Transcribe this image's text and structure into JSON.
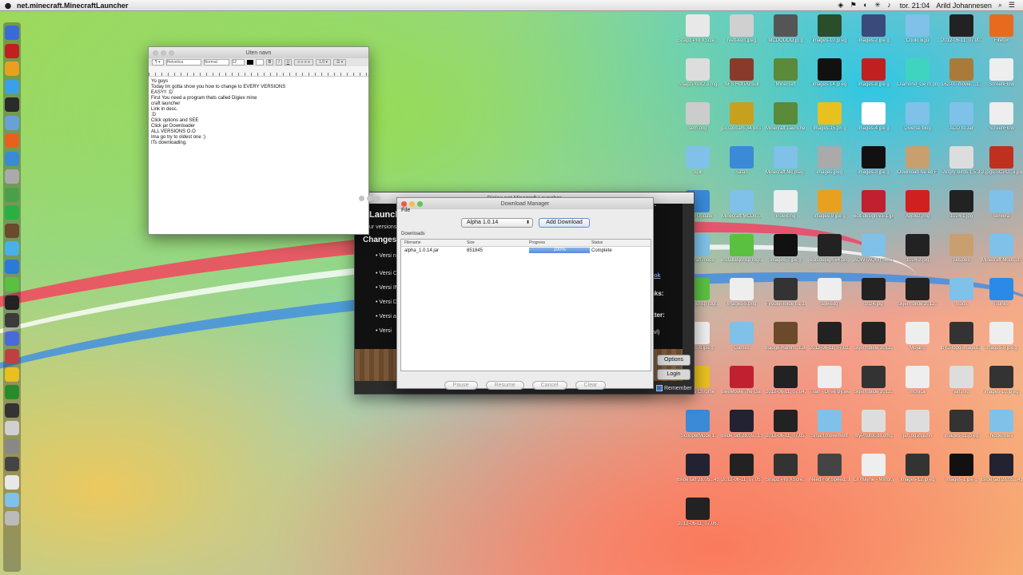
{
  "menubar": {
    "app_name": "net.minecraft.MinecraftLauncher",
    "clock": "tor. 21:04",
    "user": "Arild Johannesen"
  },
  "textedit": {
    "title": "Uten navn",
    "font": "Helvetica",
    "style": "Normal",
    "size": "12",
    "lines": [
      "Yo guys",
      "Today Im gotta show you how to change to EVERY VERSIONS",
      "EASY!! :D",
      "First You need a program thats called Digiex mine",
      "craft launcher",
      "Link in desc.",
      ":D",
      "Click options and SEE",
      "Click jar Downloader",
      "ALL VERSIONS O.O",
      "Ima go try to oldest one :)",
      "ITs downloading."
    ]
  },
  "launcher": {
    "title": "Digiex.net Minecraft Launcher",
    "launcher_label": "Launcher",
    "version_fragment": "ur versions",
    "changes_heading": "Changes",
    "bullets": [
      "Versi now l",
      "Versi Cons unus",
      "Versi IMPO Pleas",
      "Versi Delet",
      "Versi abilit if you",
      "Versi"
    ],
    "right_fragments": [
      "s:",
      "nks:",
      "itter:",
      "evl)",
      "ook"
    ],
    "options_label": "Options",
    "login_label": "Login",
    "remember_label": "Remember"
  },
  "download_manager": {
    "title": "Download Manager",
    "menu_file": "File",
    "selected_version": "Alpha 1.0.14",
    "add_download": "Add Download",
    "section": "Downloads",
    "columns": [
      "Filename",
      "Size",
      "Progress",
      "Status"
    ],
    "rows": [
      {
        "filename": "alpha_1.0.14.jar",
        "size": "851845",
        "progress": "100%",
        "status": "Complete",
        "progress_fraction": 1.0
      }
    ],
    "buttons": [
      "Pause",
      "Resume",
      "Cancel",
      "Clear"
    ]
  },
  "desktop_icons": [
    {
      "label": "Snapz Pro XScre...1.jpeg",
      "color": "#e8e8e8"
    },
    {
      "label": "Nett-kerr.jpeg",
      "color": "#d0d0d0"
    },
    {
      "label": "MCDODOO.jp g",
      "color": "#555"
    },
    {
      "label": "images-10.jp eg",
      "color": "#2a4d2a"
    },
    {
      "label": "images-2.jpe g",
      "color": "#3a4a7a"
    },
    {
      "label": "Coolo Iiigo",
      "color": "#7fc1e8"
    },
    {
      "label": "2012-06-11, 07.00.07.jpeg",
      "color": "#222"
    },
    {
      "label": "Firefox",
      "color": "#e86a1e"
    },
    {
      "label": "SnapzProX2.e mg",
      "color": "#ddd"
    },
    {
      "label": "NFS Hot Pursuit",
      "color": "#8a3a2a"
    },
    {
      "label": "Minecraft",
      "color": "#5a8a3a"
    },
    {
      "label": "images-14.jp eg",
      "color": "#111"
    },
    {
      "label": "images-8.jpe g",
      "color": "#c02020"
    },
    {
      "label": "Diamond_Ge m.png",
      "color": "#3fd4c0"
    },
    {
      "label": "162-00-movie....1.jpg",
      "color": "#aa7a3a"
    },
    {
      "label": "ScreenFlow",
      "color": "#eee"
    },
    {
      "label": "sem.png",
      "color": "#ccc"
    },
    {
      "label": "picspocam-34 8837...1.jpg",
      "color": "#c8a020"
    },
    {
      "label": "Minecraft Launcher",
      "color": "#5a8a3a"
    },
    {
      "label": "images-15.pn g",
      "color": "#e8c020"
    },
    {
      "label": "images-4.jpe g",
      "color": "#fff"
    },
    {
      "label": "Diverse blog",
      "color": "#7fc1e8"
    },
    {
      "label": "ADD to Jar",
      "color": "#7fc1e8"
    },
    {
      "label": "ScreenFlow",
      "color": "#eee"
    },
    {
      "label": "Spill",
      "color": "#7fc1e8"
    },
    {
      "label": "Safari",
      "color": "#3a8ad8"
    },
    {
      "label": "Minecraft Mc play...mele",
      "color": "#7fc1e8"
    },
    {
      "label": "images.jpeg",
      "color": "#aaa"
    },
    {
      "label": "images-3.jpe g",
      "color": "#111"
    },
    {
      "label": "Download Ne ed Fo....Zaexe",
      "color": "#c8a070"
    },
    {
      "label": "Angry Birds 1.5.3",
      "color": "#ddd"
    },
    {
      "label": "2.jpgs-SCPD...ii.jpeg",
      "color": "#c03020"
    },
    {
      "label": "Safari Update",
      "color": "#3a8ad8"
    },
    {
      "label": "Minecraft MCDo...bbury",
      "color": "#7fc1e8"
    },
    {
      "label": "indexpng",
      "color": "#eee"
    },
    {
      "label": "images-9.jpe g",
      "color": "#e8a020"
    },
    {
      "label": "edit-design-v3-1.jpg",
      "color": "#c02030"
    },
    {
      "label": "Apple2.png",
      "color": "#d02020"
    },
    {
      "label": "1024-1.jpg",
      "color": "#222"
    },
    {
      "label": "servera",
      "color": "#7fc1e8"
    },
    {
      "label": "minecraft mods",
      "color": "#7fc1e8"
    },
    {
      "label": "installasjonsp rogra...e_3",
      "color": "#5ac040"
    },
    {
      "label": "images-7.jpe g",
      "color": "#111"
    },
    {
      "label": "edit-design-v4.png",
      "color": "#222"
    },
    {
      "label": "AQW (AQW) Server",
      "color": "#7fc1e8"
    },
    {
      "label": "1024-2.jpg",
      "color": "#222"
    },
    {
      "label": "sktuoes",
      "color": "#c8a070"
    },
    {
      "label": "Minecraft Mods...torial",
      "color": "#7fc1e8"
    },
    {
      "label": "installasjonsp rogra...kcber",
      "color": "#5ac040"
    },
    {
      "label": "images-5.png",
      "color": "#eee"
    },
    {
      "label": "Firedeli-Bilde fra 10...1.jpg",
      "color": "#333"
    },
    {
      "label": "agwedg",
      "color": "#eee"
    },
    {
      "label": "1024.jpg",
      "color": "#222"
    },
    {
      "label": "Skjermbilde 2012...50",
      "color": "#222"
    },
    {
      "label": "mods",
      "color": "#7fc1e8"
    },
    {
      "label": "iTunes",
      "color": "#2a8ae8"
    },
    {
      "label": "images-6.jpe g",
      "color": "#eee"
    },
    {
      "label": "Games",
      "color": "#7fc1e8"
    },
    {
      "label": "Badge-Hamm...Edge.png",
      "color": "#6a4a2a"
    },
    {
      "label": "2012-06-11, 07.01.00.jpeg",
      "color": "#222"
    },
    {
      "label": "Skjermbilde 2012...52",
      "color": "#222"
    },
    {
      "label": "Mojang",
      "color": "#eee"
    },
    {
      "label": "bYZ-logo-images.jpg",
      "color": "#333"
    },
    {
      "label": "images-9.jpe g",
      "color": "#eee"
    },
    {
      "label": "Google Chrome",
      "color": "#e8c020"
    },
    {
      "label": "BeeMovie The Game",
      "color": "#c02030"
    },
    {
      "label": "2012-06-11, 07.04.00.jpeg",
      "color": "#222"
    },
    {
      "label": "Train - Drive By.webloc",
      "color": "#eee"
    },
    {
      "label": "Skjermbilde 2012...55",
      "color": "#333"
    },
    {
      "label": "monica",
      "color": "#eee"
    },
    {
      "label": "jan.info",
      "color": "#ddd"
    },
    {
      "label": "images-10.jp eg",
      "color": "#333"
    },
    {
      "label": "ScooperMode 1",
      "color": "#3a8ad8"
    },
    {
      "label": "Bilde tatt 28.05...15.15",
      "color": "#223"
    },
    {
      "label": "2012-06-11, 07.05.00.jpeg",
      "color": "#222"
    },
    {
      "label": "Smart movement",
      "color": "#7fc1e8"
    },
    {
      "label": "myPhotoEdit.dmg",
      "color": "#ddd"
    },
    {
      "label": "jan.og.ingunn",
      "color": "#ddd"
    },
    {
      "label": "images-11.jp eg",
      "color": "#333"
    },
    {
      "label": "hiddenfiles",
      "color": "#7fc1e8"
    },
    {
      "label": "Bilde tatt 28.05...45.#2",
      "color": "#223"
    },
    {
      "label": "2012-06-11, 07.05.29.jpeg",
      "color": "#222"
    },
    {
      "label": "Snapz Pro XScre...1.mov",
      "color": "#333"
    },
    {
      "label": "Need For Speed...bklop",
      "color": "#444"
    },
    {
      "label": "Lil Wayne - Mirror.webloc",
      "color": "#eee"
    },
    {
      "label": "images-12.jp eg",
      "color": "#333"
    },
    {
      "label": "images-1.jpe g",
      "color": "#111"
    },
    {
      "label": "Bilde tatt 28.05...45.#3",
      "color": "#223"
    },
    {
      "label": "2012-06-11, 07.06.00.jpeg",
      "color": "#222"
    }
  ]
}
